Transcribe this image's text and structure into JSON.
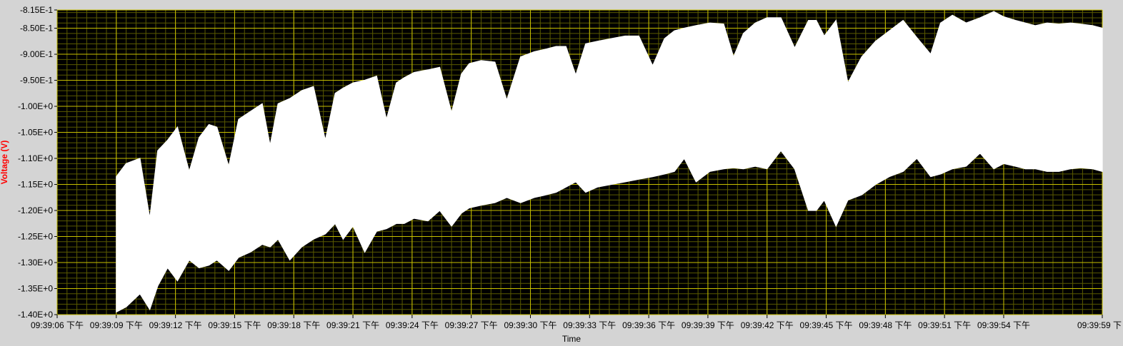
{
  "chart_data": {
    "type": "area",
    "ylabel": "Voltage (V)",
    "xlabel": "Time",
    "ylim": [
      -1.4,
      -0.815
    ],
    "y_ticks": [
      "-8.15E-1",
      "-8.50E-1",
      "-9.00E-1",
      "-9.50E-1",
      "-1.00E+0",
      "-1.05E+0",
      "-1.10E+0",
      "-1.15E+0",
      "-1.20E+0",
      "-1.25E+0",
      "-1.30E+0",
      "-1.35E+0",
      "-1.40E+0"
    ],
    "y_tick_values": [
      -0.815,
      -0.85,
      -0.9,
      -0.95,
      -1.0,
      -1.05,
      -1.1,
      -1.15,
      -1.2,
      -1.25,
      -1.3,
      -1.35,
      -1.4
    ],
    "x_range_seconds": [
      0,
      53
    ],
    "x_tick_labels": [
      "09:39:06 下午",
      "09:39:09 下午",
      "09:39:12 下午",
      "09:39:15 下午",
      "09:39:18 下午",
      "09:39:21 下午",
      "09:39:24 下午",
      "09:39:27 下午",
      "09:39:30 下午",
      "09:39:33 下午",
      "09:39:36 下午",
      "09:39:39 下午",
      "09:39:42 下午",
      "09:39:45 下午",
      "09:39:48 下午",
      "09:39:51 下午",
      "09:39:54 下午",
      "09:39:59 下"
    ],
    "x_tick_seconds": [
      0,
      3,
      6,
      9,
      12,
      15,
      18,
      21,
      24,
      27,
      30,
      33,
      36,
      39,
      42,
      45,
      48,
      53
    ],
    "grid": true,
    "colors": {
      "plot_bg": "#000000",
      "fill": "#ffffff",
      "grid_major": "#c8c000",
      "grid_minor": "#5a5a00",
      "ylabel": "#ff0000",
      "frame": "#d4d4d4"
    },
    "series": [
      {
        "x": [
          3.0,
          3.5,
          4.2,
          4.7,
          5.1,
          5.6,
          6.1,
          6.7,
          7.2,
          7.7,
          8.1,
          8.7,
          9.2,
          9.8,
          10.4,
          10.8,
          11.2,
          11.8,
          12.4,
          13.0,
          13.6,
          14.1,
          14.5,
          15.0,
          15.6,
          16.2,
          16.7,
          17.2,
          17.6,
          18.1,
          18.8,
          19.4,
          20.0,
          20.5,
          20.9,
          21.5,
          22.2,
          22.8,
          23.5,
          24.2,
          24.8,
          25.3,
          25.8,
          26.3,
          26.8,
          27.4,
          28.1,
          28.8,
          29.5,
          30.2,
          30.8,
          31.3,
          31.8,
          32.4,
          33.1,
          33.8,
          34.3,
          34.8,
          35.4,
          36.0,
          36.7,
          37.4,
          38.1,
          38.5,
          38.9,
          39.5,
          40.1,
          40.8,
          41.5,
          42.2,
          42.9,
          43.6,
          44.3,
          44.8,
          45.4,
          46.1,
          46.8,
          47.5,
          48.0,
          48.6,
          49.1,
          49.6,
          50.2,
          50.8,
          51.4,
          51.9,
          52.5,
          53.0
        ],
        "upper": [
          -1.135,
          -1.11,
          -1.1,
          -1.215,
          -1.085,
          -1.065,
          -1.04,
          -1.125,
          -1.06,
          -1.035,
          -1.04,
          -1.115,
          -1.025,
          -1.01,
          -0.995,
          -1.075,
          -0.995,
          -0.985,
          -0.97,
          -0.962,
          -1.065,
          -0.975,
          -0.965,
          -0.955,
          -0.95,
          -0.942,
          -1.025,
          -0.955,
          -0.945,
          -0.935,
          -0.93,
          -0.925,
          -1.012,
          -0.938,
          -0.918,
          -0.912,
          -0.915,
          -0.988,
          -0.905,
          -0.895,
          -0.89,
          -0.885,
          -0.885,
          -0.94,
          -0.88,
          -0.875,
          -0.87,
          -0.865,
          -0.865,
          -0.922,
          -0.87,
          -0.855,
          -0.85,
          -0.845,
          -0.84,
          -0.842,
          -0.905,
          -0.86,
          -0.84,
          -0.83,
          -0.83,
          -0.888,
          -0.835,
          -0.835,
          -0.865,
          -0.835,
          -0.955,
          -0.905,
          -0.875,
          -0.855,
          -0.835,
          -0.868,
          -0.9,
          -0.84,
          -0.825,
          -0.84,
          -0.83,
          -0.818,
          -0.828,
          -0.835,
          -0.84,
          -0.845,
          -0.84,
          -0.842,
          -0.84,
          -0.842,
          -0.845,
          -0.85
        ],
        "lower": [
          -1.395,
          -1.385,
          -1.36,
          -1.39,
          -1.345,
          -1.31,
          -1.335,
          -1.295,
          -1.31,
          -1.305,
          -1.295,
          -1.315,
          -1.29,
          -1.28,
          -1.265,
          -1.27,
          -1.255,
          -1.295,
          -1.27,
          -1.255,
          -1.245,
          -1.225,
          -1.255,
          -1.23,
          -1.28,
          -1.24,
          -1.235,
          -1.225,
          -1.225,
          -1.215,
          -1.22,
          -1.2,
          -1.23,
          -1.205,
          -1.195,
          -1.19,
          -1.185,
          -1.175,
          -1.185,
          -1.175,
          -1.17,
          -1.165,
          -1.155,
          -1.145,
          -1.165,
          -1.155,
          -1.15,
          -1.145,
          -1.14,
          -1.135,
          -1.13,
          -1.125,
          -1.1,
          -1.145,
          -1.125,
          -1.12,
          -1.118,
          -1.12,
          -1.115,
          -1.12,
          -1.085,
          -1.12,
          -1.2,
          -1.2,
          -1.18,
          -1.23,
          -1.18,
          -1.17,
          -1.15,
          -1.135,
          -1.125,
          -1.1,
          -1.135,
          -1.13,
          -1.12,
          -1.115,
          -1.09,
          -1.12,
          -1.11,
          -1.115,
          -1.12,
          -1.12,
          -1.125,
          -1.125,
          -1.12,
          -1.118,
          -1.12,
          -1.125
        ]
      }
    ]
  }
}
